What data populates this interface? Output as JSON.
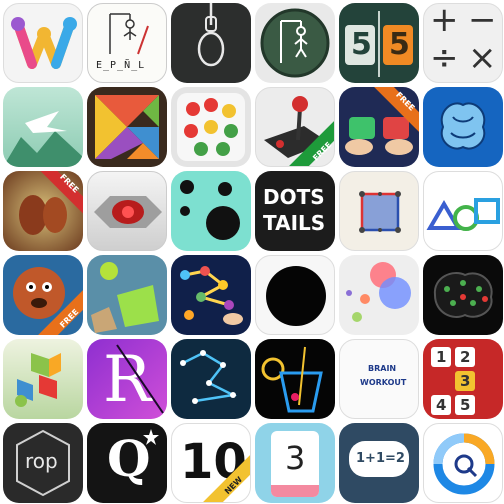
{
  "badges": {
    "free": "FREE",
    "new": "NEW"
  },
  "tiles": {
    "hangman_paper": {
      "word": "E_P_Ñ_L"
    },
    "number_flip": {
      "left": "5",
      "right": "5"
    },
    "calculator": {
      "plus": "+",
      "minus": "−",
      "divide": "÷",
      "times": "×"
    },
    "dots_tails": {
      "line1": "DOTS",
      "line2": "TAILS"
    },
    "brain_workout": {
      "line1": "BRAIN",
      "line2": "WORKOUT"
    },
    "number_tiles": {
      "n1": "1",
      "n2": "2",
      "n3": "3",
      "n4": "4",
      "n5": "5"
    },
    "rop": {
      "label": "rop"
    },
    "quiz_q": {
      "label": "Q"
    },
    "ten": {
      "label": "10"
    },
    "three": {
      "label": "3"
    },
    "math_bubble": {
      "label": "1+1=2"
    },
    "colors": {
      "accent_blue": "#1e88e5",
      "free_banner": "#e8701a",
      "dark_tile": "#2b2b2b"
    }
  }
}
